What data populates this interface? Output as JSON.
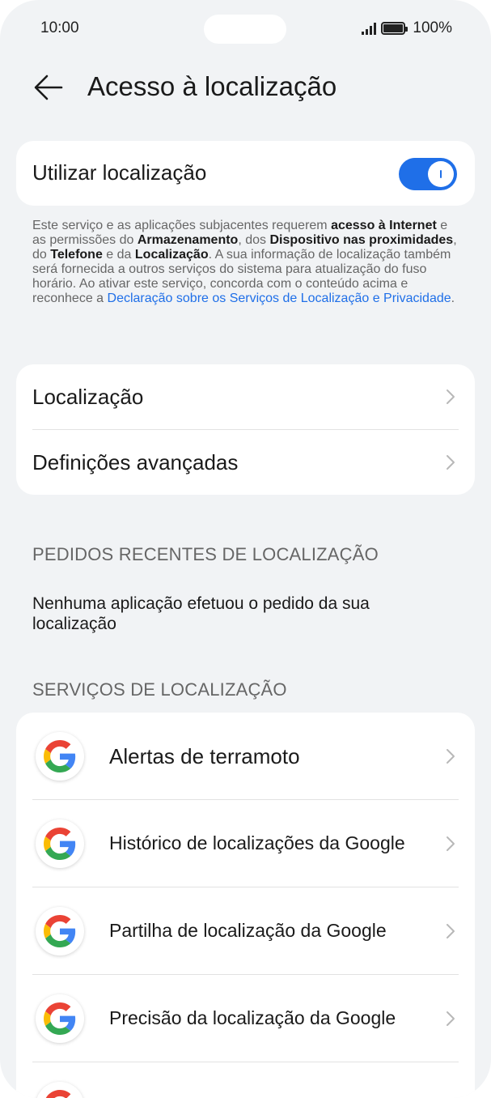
{
  "status_bar": {
    "time": "10:00",
    "battery": "100%"
  },
  "header": {
    "title": "Acesso à localização"
  },
  "location_toggle": {
    "label": "Utilizar localização",
    "state": "on"
  },
  "description": {
    "parts": [
      {
        "text": "Este serviço e as aplicações subjacentes requerem ",
        "style": "normal"
      },
      {
        "text": "acesso à Internet",
        "style": "bold"
      },
      {
        "text": " e as permissões do ",
        "style": "normal"
      },
      {
        "text": "Armazenamento",
        "style": "bold"
      },
      {
        "text": ", dos ",
        "style": "normal"
      },
      {
        "text": "Dispositivo nas proximidades",
        "style": "bold"
      },
      {
        "text": ", do ",
        "style": "normal"
      },
      {
        "text": "Telefone",
        "style": "bold"
      },
      {
        "text": " e da ",
        "style": "normal"
      },
      {
        "text": "Localização",
        "style": "bold"
      },
      {
        "text": ". A sua informação de localização também será fornecida a outros serviços do sistema para atualização do fuso horário. Ao ativar este serviço, concorda com o conteúdo acima e reconhece a ",
        "style": "normal"
      },
      {
        "text": "Declaração sobre os Serviços de Localização e Privacidade",
        "style": "link"
      },
      {
        "text": ".",
        "style": "normal"
      }
    ]
  },
  "menu": {
    "items": [
      {
        "label": "Localização"
      },
      {
        "label": "Definições avançadas"
      }
    ]
  },
  "recent_requests": {
    "title": "PEDIDOS RECENTES DE LOCALIZAÇÃO",
    "empty_text": "Nenhuma aplicação efetuou o pedido da sua localização"
  },
  "location_services": {
    "title": "SERVIÇOS DE LOCALIZAÇÃO",
    "items": [
      {
        "label": "Alertas de terramoto",
        "icon": "google-icon"
      },
      {
        "label": "Histórico de localizações da Google",
        "icon": "google-icon"
      },
      {
        "label": "Partilha de localização da Google",
        "icon": "google-icon"
      },
      {
        "label": "Precisão da localização da Google",
        "icon": "google-icon"
      }
    ]
  },
  "colors": {
    "accent": "#1f6fe8",
    "background": "#f1f3f5",
    "card": "#ffffff"
  }
}
